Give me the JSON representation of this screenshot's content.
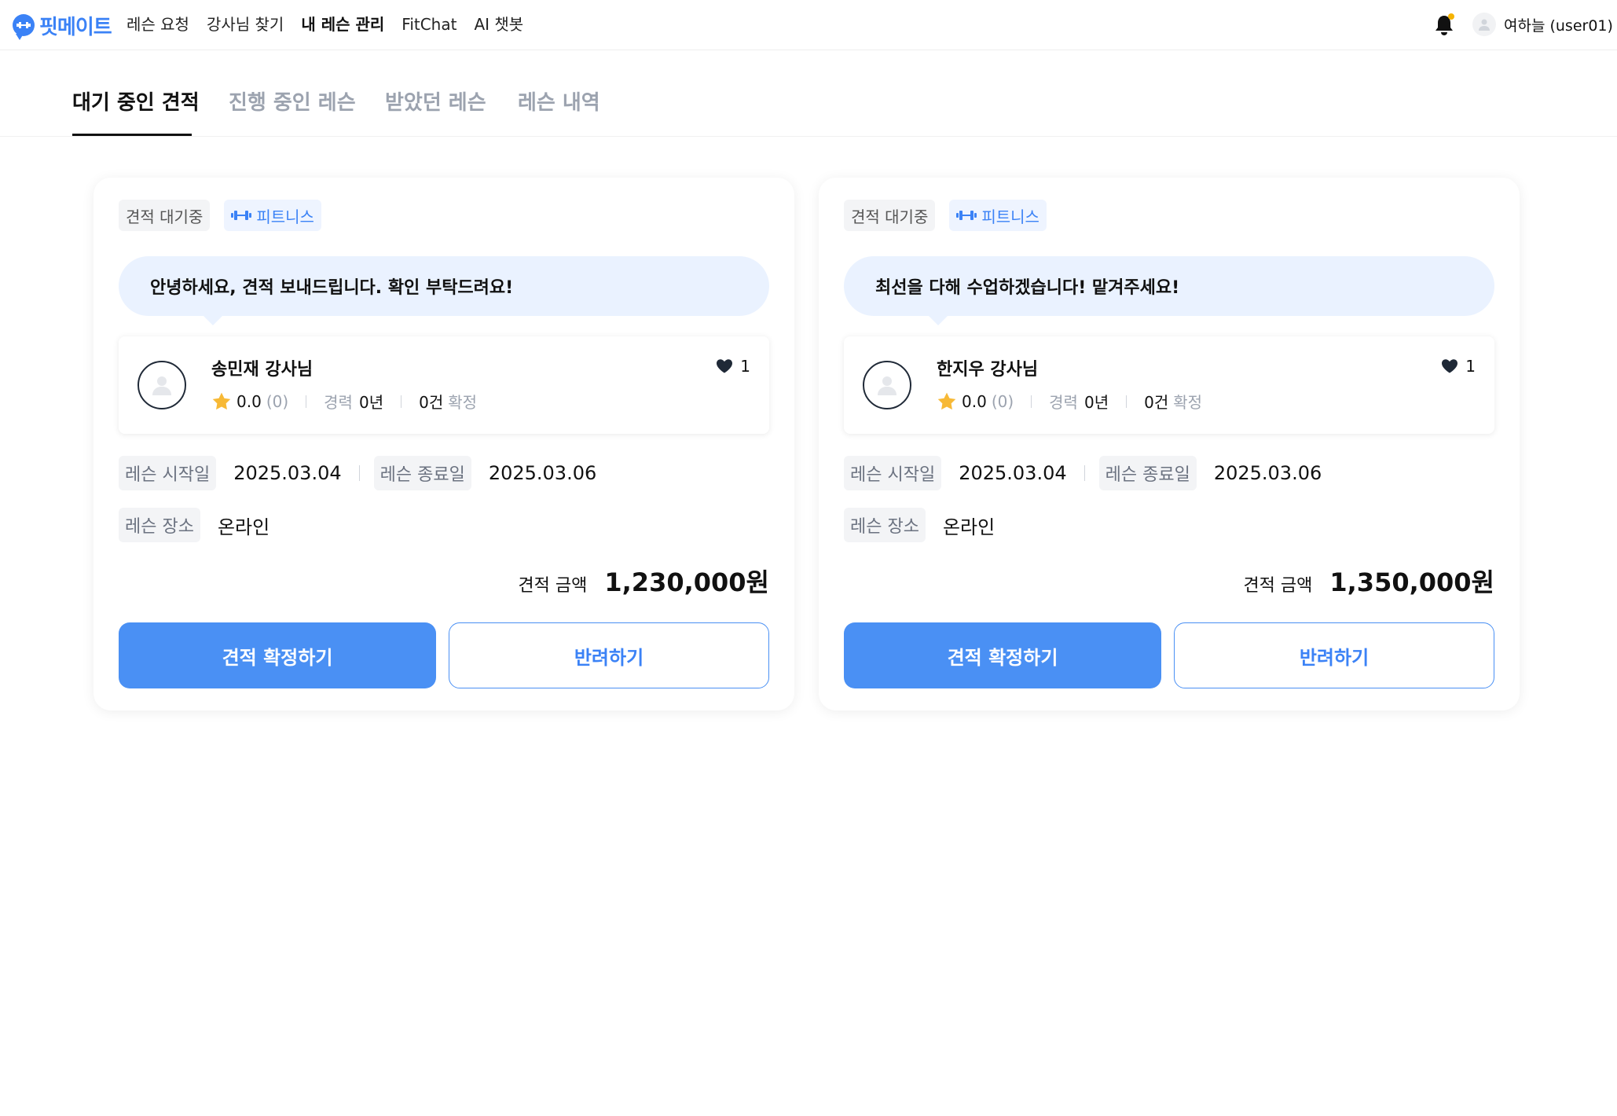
{
  "header": {
    "logo_text": "핏메이트",
    "nav": [
      {
        "label": "레슨 요청"
      },
      {
        "label": "강사님 찾기"
      },
      {
        "label": "내 레슨 관리",
        "active": true
      },
      {
        "label": "FitChat"
      },
      {
        "label": "AI 챗봇"
      }
    ],
    "user_name": "여하늘 (user01)",
    "notification_dot_color": "#f5b301"
  },
  "tabs": [
    {
      "label": "대기 중인 견적",
      "active": true
    },
    {
      "label": "진행 중인 레슨"
    },
    {
      "label": "받았던 레슨"
    },
    {
      "label": "레슨 내역"
    }
  ],
  "labels": {
    "experience": "경력",
    "confirmed": "확정",
    "start_date": "레슨 시작일",
    "end_date": "레슨 종료일",
    "location": "레슨 장소",
    "price": "견적 금액",
    "confirm_button": "견적 확정하기",
    "reject_button": "반려하기"
  },
  "quotes": [
    {
      "status": "견적 대기중",
      "category": "피트니스",
      "message": "안녕하세요, 견적 보내드립니다. 확인 부탁드려요!",
      "instructor": "송민재 강사님",
      "likes": "1",
      "rating": "0.0",
      "review_count": "(0)",
      "experience": "0년",
      "confirmed_count": "0건",
      "start_date": "2025.03.04",
      "end_date": "2025.03.06",
      "location": "온라인",
      "price": "1,230,000원"
    },
    {
      "status": "견적 대기중",
      "category": "피트니스",
      "message": "최선을 다해 수업하겠습니다! 맡겨주세요!",
      "instructor": "한지우 강사님",
      "likes": "1",
      "rating": "0.0",
      "review_count": "(0)",
      "experience": "0년",
      "confirmed_count": "0건",
      "start_date": "2025.03.04",
      "end_date": "2025.03.06",
      "location": "온라인",
      "price": "1,350,000원"
    }
  ],
  "colors": {
    "accent": "#4a90f4",
    "bubble": "#eaf2ff",
    "star": "#f7b936"
  }
}
